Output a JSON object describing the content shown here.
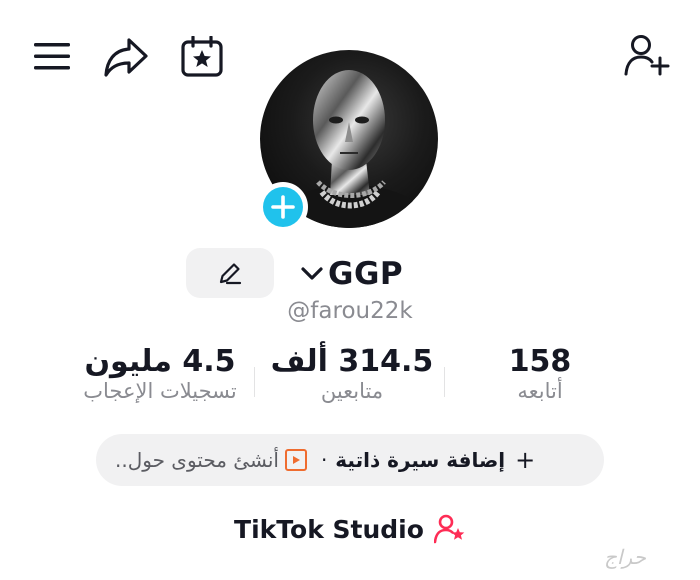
{
  "profile": {
    "username": "GGP",
    "handle": "@farou22k"
  },
  "stats": {
    "likes_value": "4.5 مليون",
    "likes_label": "تسجيلات الإعجاب",
    "followers_value": "314.5 ألف",
    "followers_label": "متابعين",
    "following_value": "158",
    "following_label": "أتابعه"
  },
  "bio_bar": {
    "add_bio": "إضافة سيرة ذاتية",
    "separator": "·",
    "create_content": "أنشئ محتوى حول..",
    "plus": "+"
  },
  "studio": {
    "label": "TikTok Studio"
  },
  "watermark": {
    "text": "حراج"
  },
  "colors": {
    "accent_cyan": "#20c2ec",
    "studio_pink": "#fe2c55",
    "play_orange": "#ef6c2f"
  },
  "icons": {
    "menu": "hamburger-menu-icon",
    "share": "share-arrow-icon",
    "calendar": "calendar-star-icon",
    "add_friend": "add-user-icon",
    "edit": "pencil-icon",
    "chevron": "chevron-down-icon",
    "play": "play-square-icon",
    "studio_person": "person-star-icon"
  }
}
